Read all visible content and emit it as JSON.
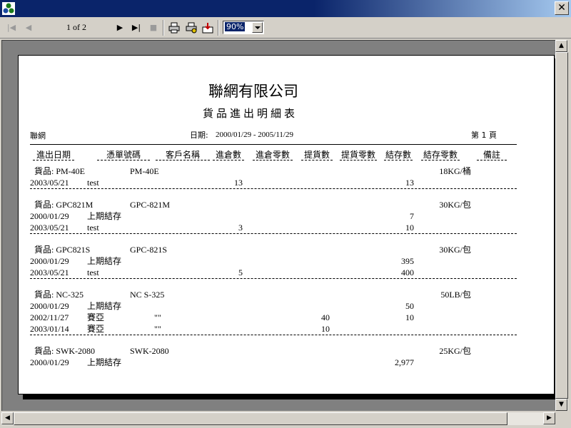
{
  "toolbar": {
    "page_indicator": "1 of 2",
    "zoom_value": "90%"
  },
  "report": {
    "company": "聯網有限公司",
    "title": "貨品進出明細表",
    "left_label": "聯網",
    "date_label": "日期:",
    "date_range": "2000/01/29 - 2005/11/29",
    "page_label": "第 1 頁",
    "columns": [
      "進出日期",
      "憑單號碼",
      "客戶名稱",
      "進倉數",
      "進倉零數",
      "提貨數",
      "提貨零數",
      "結存數",
      "結存零數",
      "備註"
    ],
    "groups": [
      {
        "item_label": "貨品: PM-40E",
        "item_name": "PM-40E",
        "unit": "18KG/桶",
        "rows": [
          {
            "date": "2003/05/21",
            "doc": "test",
            "customer": "",
            "in_qty": "13",
            "out_qty": "",
            "balance": "13"
          }
        ]
      },
      {
        "item_label": "貨品: GPC821M",
        "item_name": "GPC-821M",
        "unit": "30KG/包",
        "rows": [
          {
            "date": "2000/01/29",
            "doc": "上期結存",
            "customer": "",
            "in_qty": "",
            "out_qty": "",
            "balance": "7"
          },
          {
            "date": "2003/05/21",
            "doc": "test",
            "customer": "",
            "in_qty": "3",
            "out_qty": "",
            "balance": "10"
          }
        ]
      },
      {
        "item_label": "貨品: GPC821S",
        "item_name": "GPC-821S",
        "unit": "30KG/包",
        "rows": [
          {
            "date": "2000/01/29",
            "doc": "上期結存",
            "customer": "",
            "in_qty": "",
            "out_qty": "",
            "balance": "395"
          },
          {
            "date": "2003/05/21",
            "doc": "test",
            "customer": "",
            "in_qty": "5",
            "out_qty": "",
            "balance": "400"
          }
        ]
      },
      {
        "item_label": "貨品: NC-325",
        "item_name": "NC S-325",
        "unit": "50LB/包",
        "rows": [
          {
            "date": "2000/01/29",
            "doc": "上期結存",
            "customer": "",
            "in_qty": "",
            "out_qty": "",
            "balance": "50"
          },
          {
            "date": "2002/11/27",
            "doc": "賽亞",
            "customer": "\"\"",
            "in_qty": "",
            "out_qty": "40",
            "balance": "10"
          },
          {
            "date": "2003/01/14",
            "doc": "賽亞",
            "customer": "\"\"",
            "in_qty": "",
            "out_qty": "10",
            "balance": ""
          }
        ]
      },
      {
        "item_label": "貨品: SWK-2080",
        "item_name": "SWK-2080",
        "unit": "25KG/包",
        "rows": [
          {
            "date": "2000/01/29",
            "doc": "上期結存",
            "customer": "",
            "in_qty": "",
            "out_qty": "",
            "balance": "2,977"
          }
        ]
      }
    ]
  }
}
